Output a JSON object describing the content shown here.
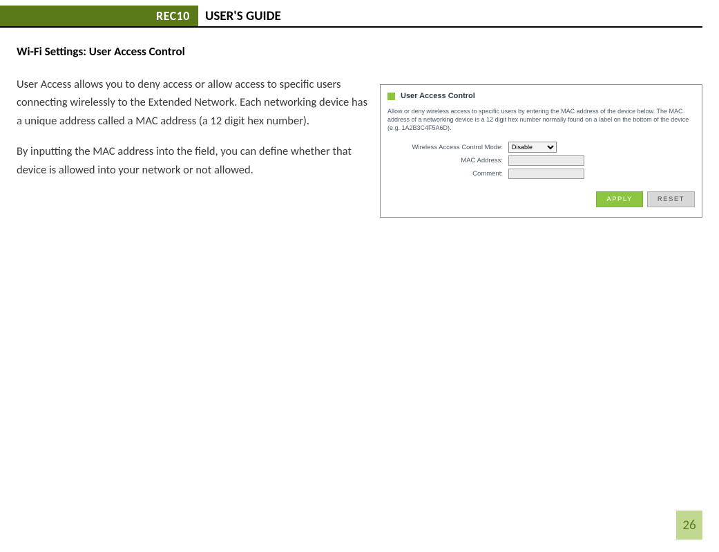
{
  "header": {
    "badge": "REC10",
    "title": "USER'S GUIDE"
  },
  "section": {
    "heading": "Wi-Fi Settings: User Access Control",
    "para1": "User Access allows you to deny access or allow access to specific users connecting wirelessly to the Extended Network.  Each networking device has a unique address called a MAC address (a 12 digit hex number).",
    "para2": "By inputting the MAC address into the field, you can define whether that device is allowed into your network or not allowed."
  },
  "panel": {
    "title": "User Access Control",
    "description": "Allow or deny wireless access to specific users by entering the MAC address of the device below. The MAC address of a networking device is a 12 digit hex number normally found on a label on the bottom of the device (e.g. 1A2B3C4F5A6D).",
    "fields": {
      "mode_label": "Wireless Access Control Mode:",
      "mode_value": "Disable",
      "mac_label": "MAC Address:",
      "comment_label": "Comment:"
    },
    "buttons": {
      "apply": "APPLY",
      "reset": "RESET"
    }
  },
  "page_number": "26"
}
